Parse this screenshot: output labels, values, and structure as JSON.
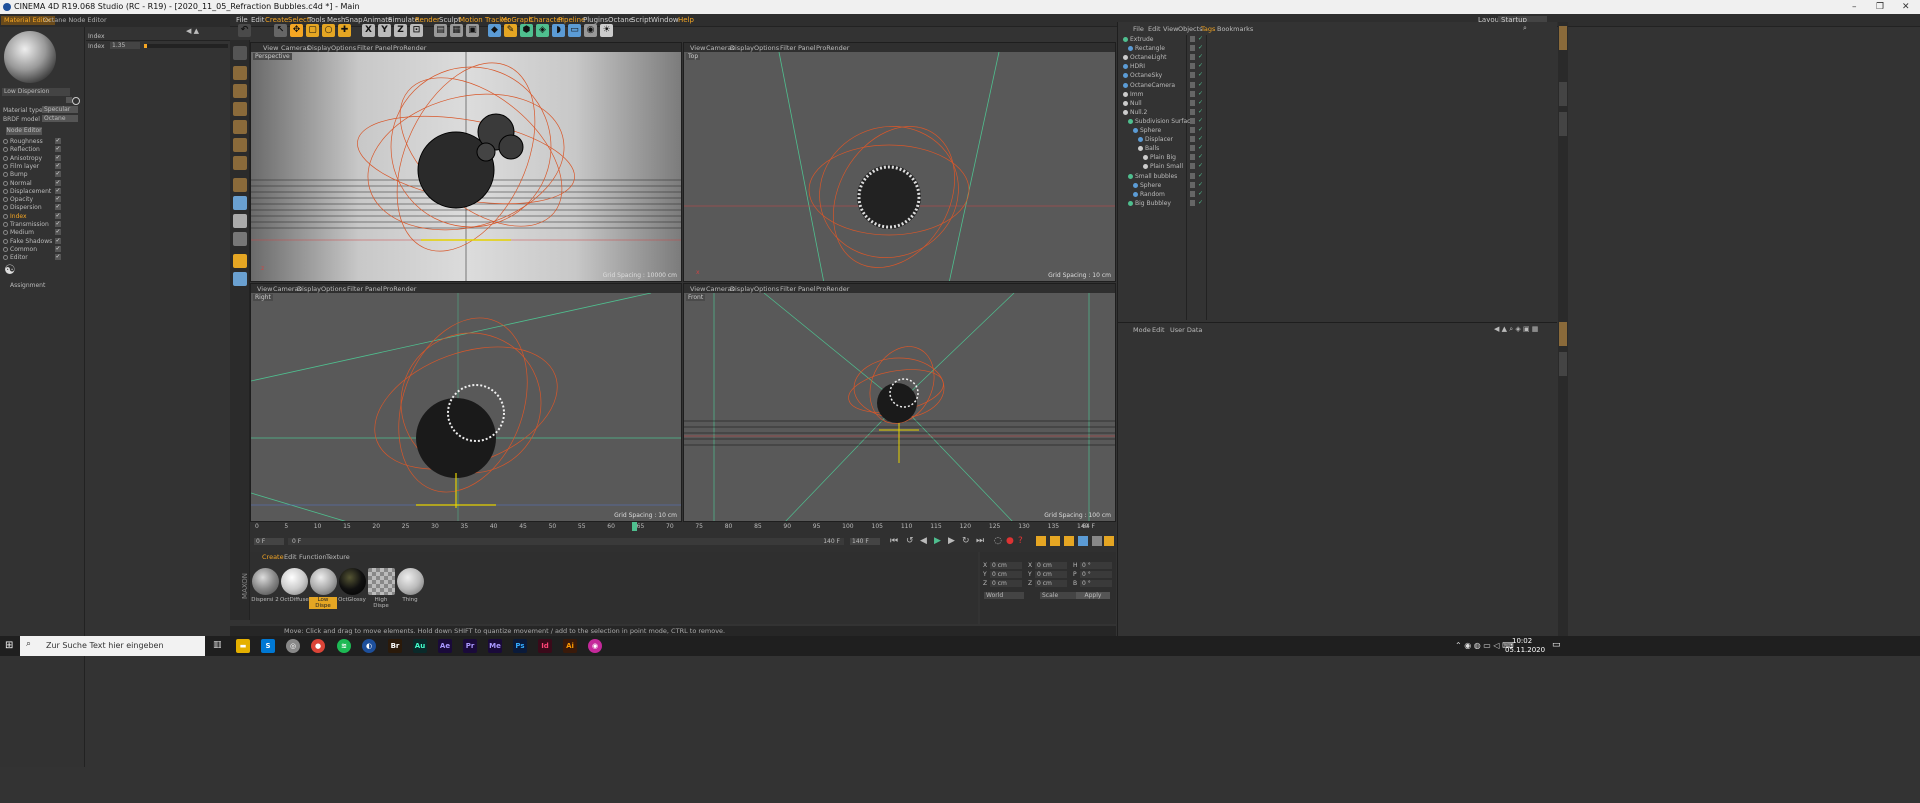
{
  "window": {
    "title": "CINEMA 4D R19.068 Studio (RC - R19) - [2020_11_05_Refraction Bubbles.c4d *] - Main",
    "min": "–",
    "max": "❐",
    "close": "✕"
  },
  "menu": [
    "File",
    "Edit",
    "Create",
    "Select",
    "Tools",
    "Mesh",
    "Snap",
    "Animate",
    "Simulate",
    "Render",
    "Sculpt",
    "Motion Tracker",
    "MoGraph",
    "Character",
    "Pipeline",
    "Plugins",
    "Octane",
    "Script",
    "Window",
    "Help"
  ],
  "layout": {
    "label": "Layout:",
    "value": "Startup"
  },
  "left_tabs": {
    "material_editor": "Material Editor",
    "octane_node_editor": "Octane Node Editor"
  },
  "material": {
    "name": "Low Dispersion",
    "material_type_label": "Material type",
    "material_type_value": "Specular",
    "brdf_label": "BRDF model",
    "brdf_value": "Octane",
    "node_editor": "Node Editor",
    "channels": [
      "Roughness",
      "Reflection",
      "Anisotropy",
      "Film layer",
      "Bump",
      "Normal",
      "Displacement",
      "Opacity",
      "Dispersion",
      "Index",
      "Transmission",
      "Medium",
      "Fake Shadows",
      "Common",
      "Editor"
    ],
    "active_channel": "Index",
    "assignment": "Assignment"
  },
  "attr": {
    "header": "Index",
    "index_label": "Index",
    "index_value": "1.35"
  },
  "viewports": [
    {
      "menu": [
        "View",
        "Cameras",
        "Display",
        "Options",
        "Filter",
        "Panel",
        "ProRender"
      ],
      "label": "Perspective",
      "grid": "Grid Spacing : 10000 cm"
    },
    {
      "menu": [
        "View",
        "Cameras",
        "Display",
        "Options",
        "Filter",
        "Panel",
        "ProRender"
      ],
      "label": "Top",
      "grid": "Grid Spacing : 10 cm"
    },
    {
      "menu": [
        "View",
        "Cameras",
        "Display",
        "Options",
        "Filter",
        "Panel",
        "ProRender"
      ],
      "label": "Right",
      "grid": "Grid Spacing : 10 cm"
    },
    {
      "menu": [
        "View",
        "Cameras",
        "Display",
        "Options",
        "Filter",
        "Panel",
        "ProRender"
      ],
      "label": "Front",
      "grid": "Grid Spacing : 100 cm"
    }
  ],
  "timeline": {
    "ticks": [
      "0",
      "5",
      "10",
      "15",
      "20",
      "25",
      "30",
      "35",
      "40",
      "45",
      "50",
      "55",
      "60",
      "65",
      "70",
      "75",
      "80",
      "85",
      "90",
      "95",
      "100",
      "105",
      "110",
      "115",
      "120",
      "125",
      "130",
      "135",
      "140"
    ],
    "current_frame": "64",
    "end_label": "64 F",
    "start_field": "0 F",
    "start_field2": "0 F",
    "end_field": "140 F",
    "end_field2": "140 F"
  },
  "material_manager": {
    "menu": [
      "Create",
      "Edit",
      "Function",
      "Texture"
    ],
    "materials": [
      "Dispersi 2",
      "OctDiffuse",
      "Low Dispe",
      "OctGlossy",
      "High Dispe",
      "Thing"
    ],
    "active": "Low Dispe"
  },
  "coords": {
    "rows": [
      [
        "X",
        "0 cm",
        "X",
        "0 cm",
        "H",
        "0 °"
      ],
      [
        "Y",
        "0 cm",
        "Y",
        "0 cm",
        "P",
        "0 °"
      ],
      [
        "Z",
        "0 cm",
        "Z",
        "0 cm",
        "B",
        "0 °"
      ]
    ],
    "mode": "World",
    "size": "Scale",
    "apply": "Apply"
  },
  "status": "Move: Click and drag to move elements. Hold down SHIFT to quantize movement / add to the selection in point mode, CTRL to remove.",
  "object_manager": {
    "menu": [
      "File",
      "Edit",
      "View",
      "Objects",
      "Tags",
      "Bookmarks"
    ],
    "objects": [
      {
        "name": "Extrude",
        "indent": 0
      },
      {
        "name": "Rectangle",
        "indent": 1
      },
      {
        "name": "OctaneLight",
        "indent": 0
      },
      {
        "name": "HDRI",
        "indent": 0
      },
      {
        "name": "OctaneSky",
        "indent": 0
      },
      {
        "name": "OctaneCamera",
        "indent": 0
      },
      {
        "name": "Imm",
        "indent": 0
      },
      {
        "name": "Null",
        "indent": 0
      },
      {
        "name": "Null.2",
        "indent": 0
      },
      {
        "name": "Subdivision Surface",
        "indent": 1
      },
      {
        "name": "Sphere",
        "indent": 2
      },
      {
        "name": "Displacer",
        "indent": 3
      },
      {
        "name": "Balls",
        "indent": 3
      },
      {
        "name": "Plain Big",
        "indent": 4
      },
      {
        "name": "Plain Small",
        "indent": 4
      },
      {
        "name": "Small bubbles",
        "indent": 1
      },
      {
        "name": "Sphere",
        "indent": 2
      },
      {
        "name": "Random",
        "indent": 2
      },
      {
        "name": "Big Bubbley",
        "indent": 1
      }
    ]
  },
  "attr_manager": {
    "menu": [
      "Mode",
      "Edit",
      "User Data"
    ]
  },
  "taskbar": {
    "search_placeholder": "Zur Suche Text hier eingeben",
    "apps": [
      "Br",
      "Au",
      "Ae",
      "Pr",
      "Me",
      "Ps",
      "Id",
      "Ai"
    ],
    "time": "10:02",
    "date": "05.11.2020"
  },
  "colors": {
    "accent": "#f5a623",
    "viewport": "#595959",
    "panel": "#333333",
    "wire": "#d8572a",
    "green": "#4fbf8f"
  }
}
